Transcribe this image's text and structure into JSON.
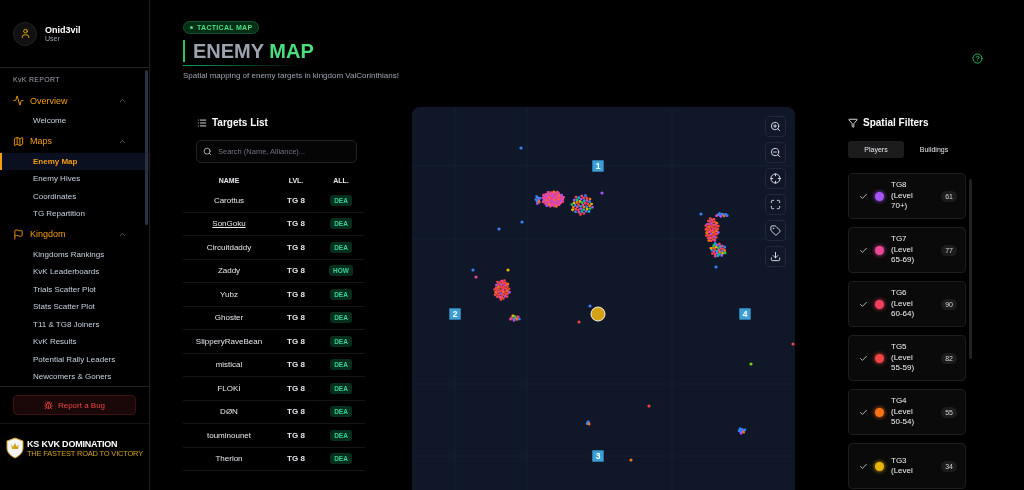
{
  "user": {
    "name": "Onid3vil",
    "role": "User"
  },
  "sidebar": {
    "section_label": "KvK REPORT",
    "groups": [
      {
        "label": "Overview",
        "expanded": true,
        "items": [
          {
            "label": "Welcome",
            "selected": false
          }
        ]
      },
      {
        "label": "Maps",
        "expanded": true,
        "items": [
          {
            "label": "Enemy Map",
            "selected": true
          },
          {
            "label": "Enemy Hives",
            "selected": false
          },
          {
            "label": "Coordinates",
            "selected": false
          },
          {
            "label": "TG Repartition",
            "selected": false
          }
        ]
      },
      {
        "label": "Kingdom",
        "expanded": true,
        "items": [
          {
            "label": "Kingdoms Rankings",
            "selected": false
          },
          {
            "label": "KvK Leaderboards",
            "selected": false
          },
          {
            "label": "Trials Scatter Plot",
            "selected": false
          },
          {
            "label": "Stats Scatter Plot",
            "selected": false
          },
          {
            "label": "T11 & TG8 Joiners",
            "selected": false
          },
          {
            "label": "KvK Results",
            "selected": false
          },
          {
            "label": "Potential Rally Leaders",
            "selected": false
          },
          {
            "label": "Newcomers & Goners",
            "selected": false
          }
        ]
      }
    ],
    "report_button": "Report a Bug",
    "logo": {
      "title": "KS KVK DOMINATION",
      "tagline": "THE FASTEST ROAD TO VICTORY"
    }
  },
  "header": {
    "badge": "TACTICAL MAP",
    "title_first": "ENEMY",
    "title_second": "MAP",
    "subtitle": "Spatial mapping of enemy targets in kingdom VaiCorinthians!"
  },
  "targets": {
    "title": "Targets List",
    "search": {
      "placeholder": "Search (Name, Alliance)..."
    },
    "columns": [
      "NAME",
      "LVL.",
      "ALL."
    ],
    "rows": [
      {
        "name": "Carottus",
        "level": "TG 8",
        "alliance": "DEA",
        "hovered": false
      },
      {
        "name": "SonGoku",
        "level": "TG 8",
        "alliance": "DEA",
        "hovered": true
      },
      {
        "name": "Circuitdaddy",
        "level": "TG 8",
        "alliance": "DEA",
        "hovered": false
      },
      {
        "name": "Zaddy",
        "level": "TG 8",
        "alliance": "HOW",
        "hovered": false
      },
      {
        "name": "Yubz",
        "level": "TG 8",
        "alliance": "DEA",
        "hovered": false
      },
      {
        "name": "Ghoster",
        "level": "TG 8",
        "alliance": "DEA",
        "hovered": false
      },
      {
        "name": "SlipperyRaveBean",
        "level": "TG 8",
        "alliance": "DEA",
        "hovered": false
      },
      {
        "name": "mistical",
        "level": "TG 8",
        "alliance": "DEA",
        "hovered": false
      },
      {
        "name": "FLOKİ",
        "level": "TG 8",
        "alliance": "DEA",
        "hovered": false
      },
      {
        "name": "DØN",
        "level": "TG 8",
        "alliance": "DEA",
        "hovered": false
      },
      {
        "name": "touminounet",
        "level": "TG 8",
        "alliance": "DEA",
        "hovered": false
      },
      {
        "name": "Therion",
        "level": "TG 8",
        "alliance": "DEA",
        "hovered": false
      }
    ]
  },
  "map": {
    "zone_markers": [
      "1",
      "2",
      "3",
      "4"
    ]
  },
  "filters": {
    "title": "Spatial Filters",
    "tabs": [
      {
        "label": "Players",
        "selected": true
      },
      {
        "label": "Buildings",
        "selected": false
      }
    ],
    "items": [
      {
        "label": "TG8 (Level 70+)",
        "count": "61",
        "color": "#a855f7",
        "checked": true
      },
      {
        "label": "TG7 (Level 65-69)",
        "count": "77",
        "color": "#ec4899",
        "checked": true
      },
      {
        "label": "TG6 (Level 60-64)",
        "count": "90",
        "color": "#f43f5e",
        "checked": true
      },
      {
        "label": "TG5 (Level 55-59)",
        "count": "82",
        "color": "#ef4444",
        "checked": true
      },
      {
        "label": "TG4 (Level 50-54)",
        "count": "55",
        "color": "#f97316",
        "checked": true
      },
      {
        "label": "TG3 (Level",
        "count": "34",
        "color": "#eab308",
        "checked": true
      }
    ]
  }
}
